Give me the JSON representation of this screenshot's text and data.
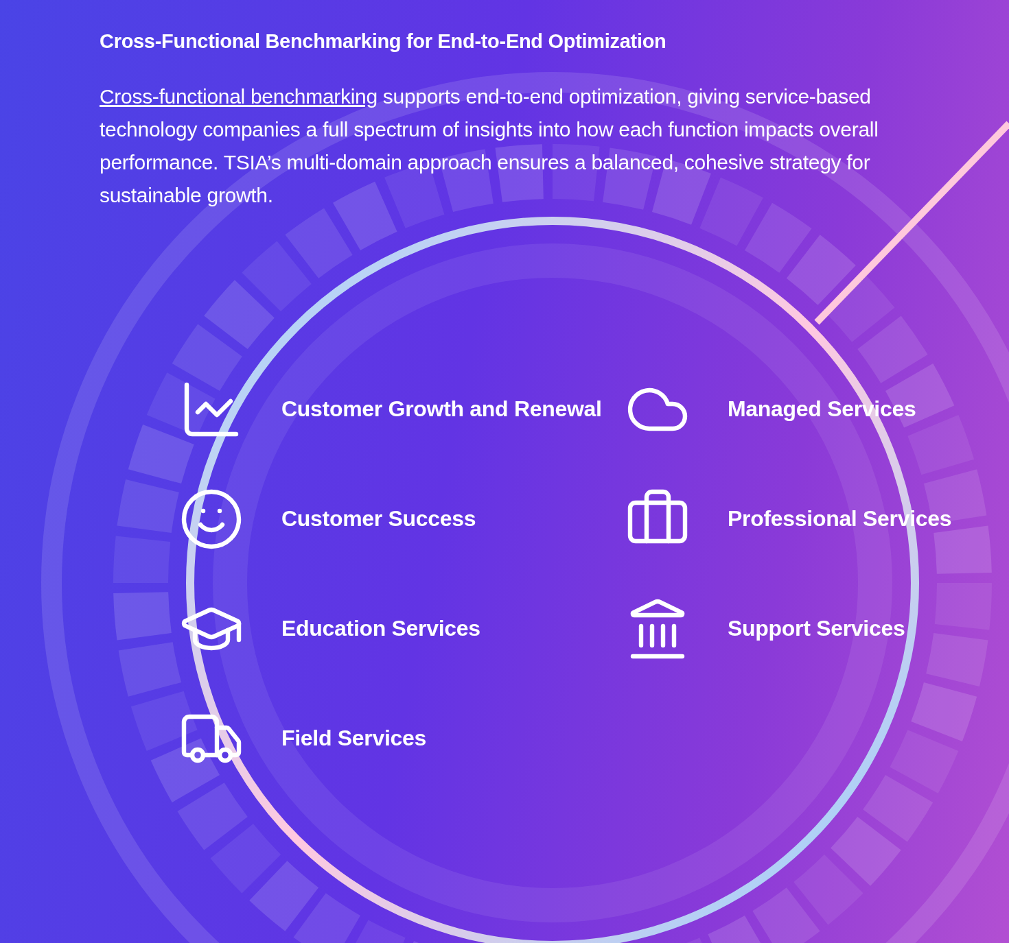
{
  "heading": "Cross-Functional Benchmarking for End-to-End Optimization",
  "intro": {
    "link": "Cross-functional benchmarking",
    "text": " supports end-to-end optimization, giving service-based technology companies a full spectrum of insights into how each function impacts overall performance. TSIA’s multi-domain approach ensures a balanced, cohesive strategy for sustainable growth."
  },
  "services": [
    {
      "kind": "growth",
      "label": "Customer Growth and Renewal"
    },
    {
      "kind": "cloud",
      "label": "Managed Services"
    },
    {
      "kind": "smile",
      "label": "Customer Success"
    },
    {
      "kind": "briefcase",
      "label": "Professional Services"
    },
    {
      "kind": "education",
      "label": "Education Services"
    },
    {
      "kind": "bank",
      "label": "Support Services"
    },
    {
      "kind": "truck",
      "label": "Field Services"
    }
  ]
}
